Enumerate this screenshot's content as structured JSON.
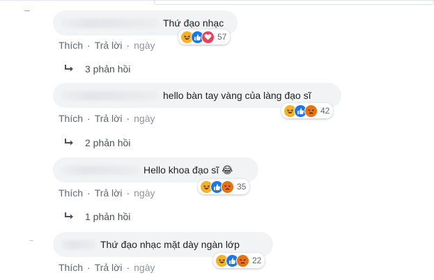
{
  "comments": [
    {
      "text": "Thứ đạo nhạc",
      "name_partial": "",
      "reactions": [
        "haha",
        "like",
        "love"
      ],
      "reaction_count": "57",
      "actions": {
        "like": "Thích",
        "reply": "Trả lời",
        "time": "ngày"
      },
      "replies_label": "3 phản hồi"
    },
    {
      "text": "hello bàn tay vàng của làng đạo sĩ",
      "name_partial": "",
      "reactions": [
        "haha",
        "like",
        "angry"
      ],
      "reaction_count": "42",
      "actions": {
        "like": "Thích",
        "reply": "Trả lời",
        "time": "ngày"
      },
      "replies_label": "2 phản hồi"
    },
    {
      "text": "Hello khoa đạo sĩ 😂",
      "name_partial": "",
      "reactions": [
        "haha",
        "like",
        "angry"
      ],
      "reaction_count": "35",
      "actions": {
        "like": "Thích",
        "reply": "Trả lời",
        "time": "ngày"
      },
      "replies_label": "1 phản hồi"
    },
    {
      "text": "Thứ đạo nhạc mặt dày ngàn lớp",
      "name_partial": "",
      "reactions": [
        "haha",
        "like",
        "angry"
      ],
      "reaction_count": "22",
      "actions": {
        "like": "Thích",
        "reply": "Trả lời",
        "time": "ngày"
      },
      "replies_label": ""
    }
  ],
  "separator": "·",
  "colors": {
    "bubble": "#f2f3f5",
    "link": "#606770",
    "like": "#1877f2",
    "love": "#f33e58",
    "haha": "#f7b125",
    "angry": "#e9710f"
  },
  "icons": {
    "reply_arrow": "reply-arrow-icon"
  }
}
